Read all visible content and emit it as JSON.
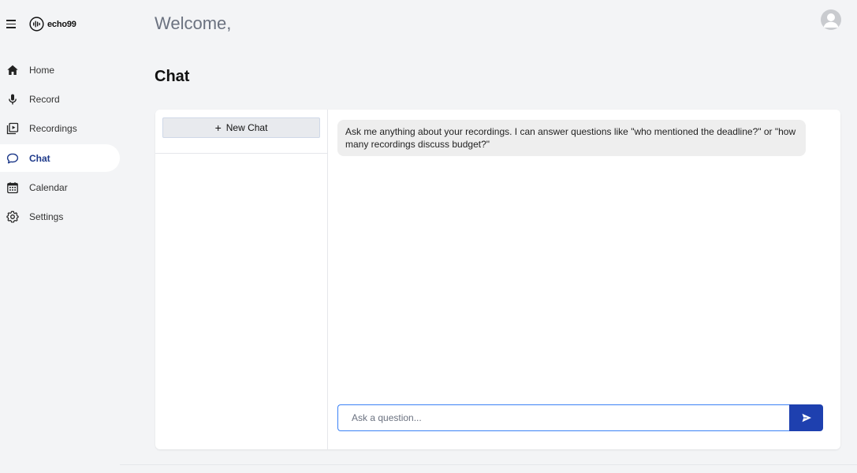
{
  "brand": {
    "name": "echo99",
    "icon": "audio-wave-logo-icon"
  },
  "sidebar": {
    "items": [
      {
        "label": "Home",
        "icon": "home-icon",
        "active": false
      },
      {
        "label": "Record",
        "icon": "microphone-icon",
        "active": false
      },
      {
        "label": "Recordings",
        "icon": "play-library-icon",
        "active": false
      },
      {
        "label": "Chat",
        "icon": "chat-bubble-icon",
        "active": true
      },
      {
        "label": "Calendar",
        "icon": "calendar-icon",
        "active": false
      },
      {
        "label": "Settings",
        "icon": "gear-icon",
        "active": false
      }
    ]
  },
  "header": {
    "welcome": "Welcome,",
    "avatar_icon": "user-avatar-icon"
  },
  "page": {
    "title": "Chat"
  },
  "chat": {
    "new_chat_label": "New Chat",
    "assistant_message": "Ask me anything about your recordings. I can answer questions like \"who mentioned the deadline?\" or \"how many recordings discuss budget?\"",
    "input_placeholder": "Ask a question...",
    "input_value": "",
    "send_icon": "send-icon"
  },
  "colors": {
    "accent": "#1e40af",
    "active_label": "#1e3a8a",
    "background": "#f3f4f6"
  }
}
